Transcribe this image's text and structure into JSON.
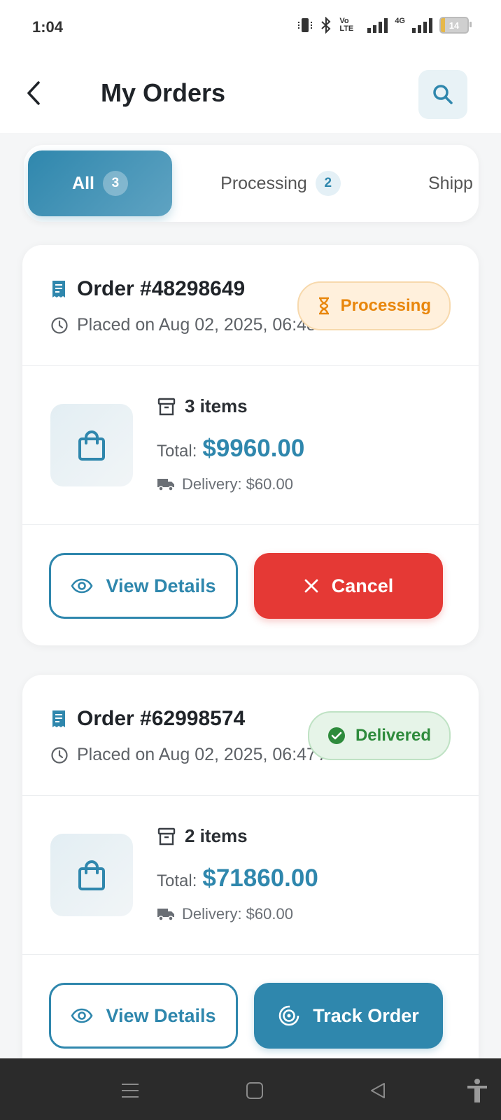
{
  "status_bar": {
    "time": "1:04",
    "network_label": "4G",
    "volte_label": "Vo LTE",
    "battery_level": "14"
  },
  "header": {
    "title": "My Orders",
    "back_icon": "chevron-left-icon",
    "search_icon": "search-icon"
  },
  "tabs": [
    {
      "label": "All",
      "count": "3",
      "active": true
    },
    {
      "label": "Processing",
      "count": "2",
      "active": false
    },
    {
      "label": "Shipp",
      "active": false
    }
  ],
  "orders": [
    {
      "title": "Order #48298649",
      "placed": "Placed on Aug 02, 2025, 06:48 PM",
      "status": "Processing",
      "status_color": "#e8860c",
      "items": "3 items",
      "total_label": "Total:",
      "total": "$9960.00",
      "delivery": "Delivery: $60.00",
      "primary_action": "View Details",
      "secondary_action": "Cancel",
      "secondary_color": "#e53935"
    },
    {
      "title": "Order #62998574",
      "placed": "Placed on Aug 02, 2025, 06:47 AM",
      "status": "Delivered",
      "status_color": "#2e8b3c",
      "items": "2 items",
      "total_label": "Total:",
      "total": "$71860.00",
      "delivery": "Delivery: $60.00",
      "primary_action": "View Details",
      "secondary_action": "Track Order",
      "secondary_color": "#2f87ad"
    }
  ],
  "colors": {
    "accent": "#2f87ad",
    "danger": "#e53935",
    "processing": "#e8860c",
    "delivered": "#2e8b3c"
  }
}
